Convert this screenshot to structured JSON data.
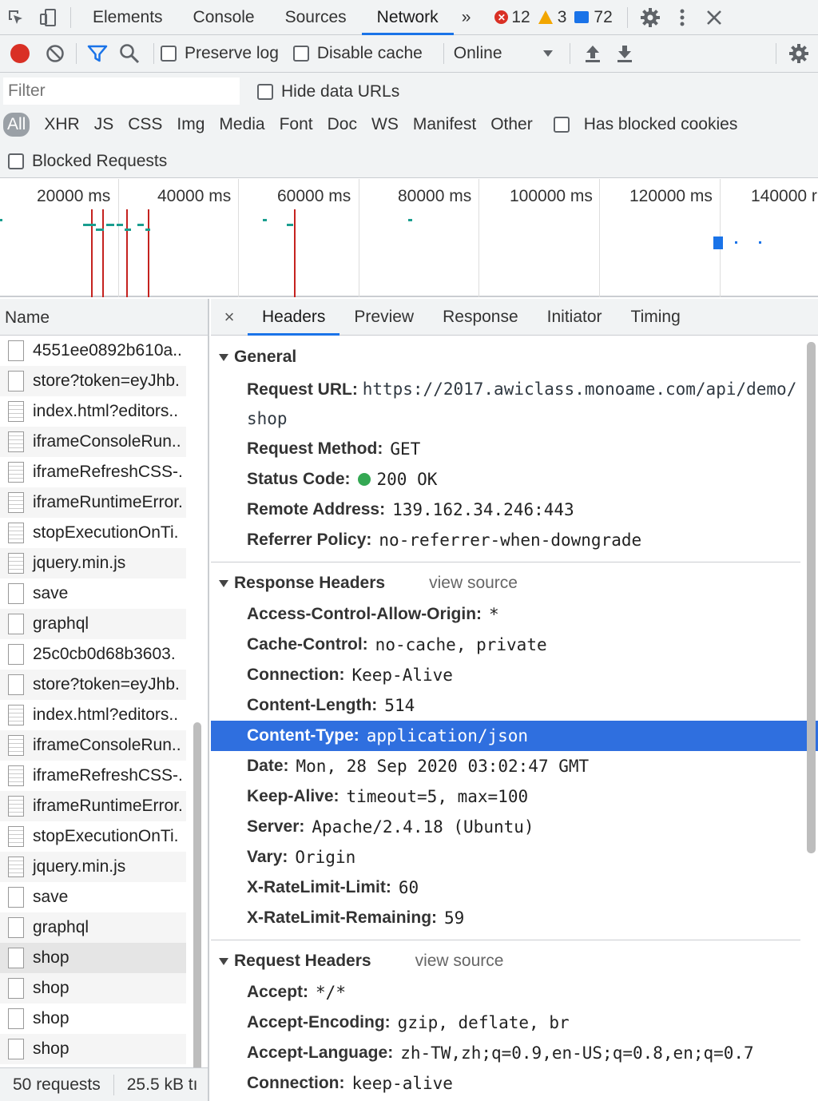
{
  "tabs": [
    "Elements",
    "Console",
    "Sources",
    "Network"
  ],
  "more_tabs": "»",
  "counts": {
    "errors": "12",
    "warnings": "3",
    "messages": "72"
  },
  "toolbar": {
    "preserve_log": "Preserve log",
    "disable_cache": "Disable cache",
    "throttle": "Online"
  },
  "filter": {
    "placeholder": "Filter",
    "hide_data_urls": "Hide data URLs",
    "types": [
      "All",
      "XHR",
      "JS",
      "CSS",
      "Img",
      "Media",
      "Font",
      "Doc",
      "WS",
      "Manifest",
      "Other"
    ],
    "has_blocked_cookies": "Has blocked cookies",
    "blocked_requests": "Blocked Requests"
  },
  "timeline": {
    "ticks": [
      "20000 ms",
      "40000 ms",
      "60000 ms",
      "80000 ms",
      "100000 ms",
      "120000 ms",
      "140000 r"
    ]
  },
  "list": {
    "header": "Name",
    "rows": [
      {
        "name": "4551ee0892b610a..",
        "icon": "file"
      },
      {
        "name": "store?token=eyJhb.",
        "icon": "file"
      },
      {
        "name": "index.html?editors..",
        "icon": "doc"
      },
      {
        "name": "iframeConsoleRun..",
        "icon": "doc"
      },
      {
        "name": "iframeRefreshCSS-.",
        "icon": "doc"
      },
      {
        "name": "iframeRuntimeError.",
        "icon": "doc"
      },
      {
        "name": "stopExecutionOnTi.",
        "icon": "doc"
      },
      {
        "name": "jquery.min.js",
        "icon": "doc"
      },
      {
        "name": "save",
        "icon": "file"
      },
      {
        "name": "graphql",
        "icon": "file"
      },
      {
        "name": "25c0cb0d68b3603.",
        "icon": "file"
      },
      {
        "name": "store?token=eyJhb.",
        "icon": "file"
      },
      {
        "name": "index.html?editors..",
        "icon": "doc"
      },
      {
        "name": "iframeConsoleRun..",
        "icon": "doc"
      },
      {
        "name": "iframeRefreshCSS-.",
        "icon": "doc"
      },
      {
        "name": "iframeRuntimeError.",
        "icon": "doc"
      },
      {
        "name": "stopExecutionOnTi.",
        "icon": "doc"
      },
      {
        "name": "jquery.min.js",
        "icon": "doc"
      },
      {
        "name": "save",
        "icon": "file"
      },
      {
        "name": "graphql",
        "icon": "file"
      },
      {
        "name": "shop",
        "icon": "file",
        "selected": true
      },
      {
        "name": "shop",
        "icon": "file"
      },
      {
        "name": "shop",
        "icon": "file"
      },
      {
        "name": "shop",
        "icon": "file"
      }
    ],
    "footer_requests": "50 requests",
    "footer_size": "25.5 kB tı"
  },
  "detail": {
    "close": "×",
    "tabs": [
      "Headers",
      "Preview",
      "Response",
      "Initiator",
      "Timing"
    ],
    "general": {
      "title": "General",
      "request_url_label": "Request URL:",
      "request_url": "https://2017.awiclass.monoame.com/api/demo/shop",
      "method_label": "Request Method:",
      "method": "GET",
      "status_label": "Status Code:",
      "status": "200  OK",
      "remote_label": "Remote Address:",
      "remote": "139.162.34.246:443",
      "referrer_label": "Referrer Policy:",
      "referrer": "no-referrer-when-downgrade"
    },
    "response_headers": {
      "title": "Response Headers",
      "view_source": "view source",
      "items": [
        {
          "k": "Access-Control-Allow-Origin:",
          "v": "*"
        },
        {
          "k": "Cache-Control:",
          "v": "no-cache, private"
        },
        {
          "k": "Connection:",
          "v": "Keep-Alive"
        },
        {
          "k": "Content-Length:",
          "v": "514"
        },
        {
          "k": "Content-Type:",
          "v": "application/json",
          "highlight": true
        },
        {
          "k": "Date:",
          "v": "Mon, 28 Sep 2020 03:02:47 GMT"
        },
        {
          "k": "Keep-Alive:",
          "v": "timeout=5, max=100"
        },
        {
          "k": "Server:",
          "v": "Apache/2.4.18 (Ubuntu)"
        },
        {
          "k": "Vary:",
          "v": "Origin"
        },
        {
          "k": "X-RateLimit-Limit:",
          "v": "60"
        },
        {
          "k": "X-RateLimit-Remaining:",
          "v": "59"
        }
      ]
    },
    "request_headers": {
      "title": "Request Headers",
      "view_source": "view source",
      "items": [
        {
          "k": "Accept:",
          "v": "*/*"
        },
        {
          "k": "Accept-Encoding:",
          "v": "gzip, deflate, br"
        },
        {
          "k": "Accept-Language:",
          "v": "zh-TW,zh;q=0.9,en-US;q=0.8,en;q=0.7"
        },
        {
          "k": "Connection:",
          "v": "keep-alive"
        }
      ]
    }
  },
  "colors": {
    "accent": "#1a73e8",
    "record": "#d93025",
    "highlight": "#2f6fdf",
    "status_ok": "#34a853"
  }
}
